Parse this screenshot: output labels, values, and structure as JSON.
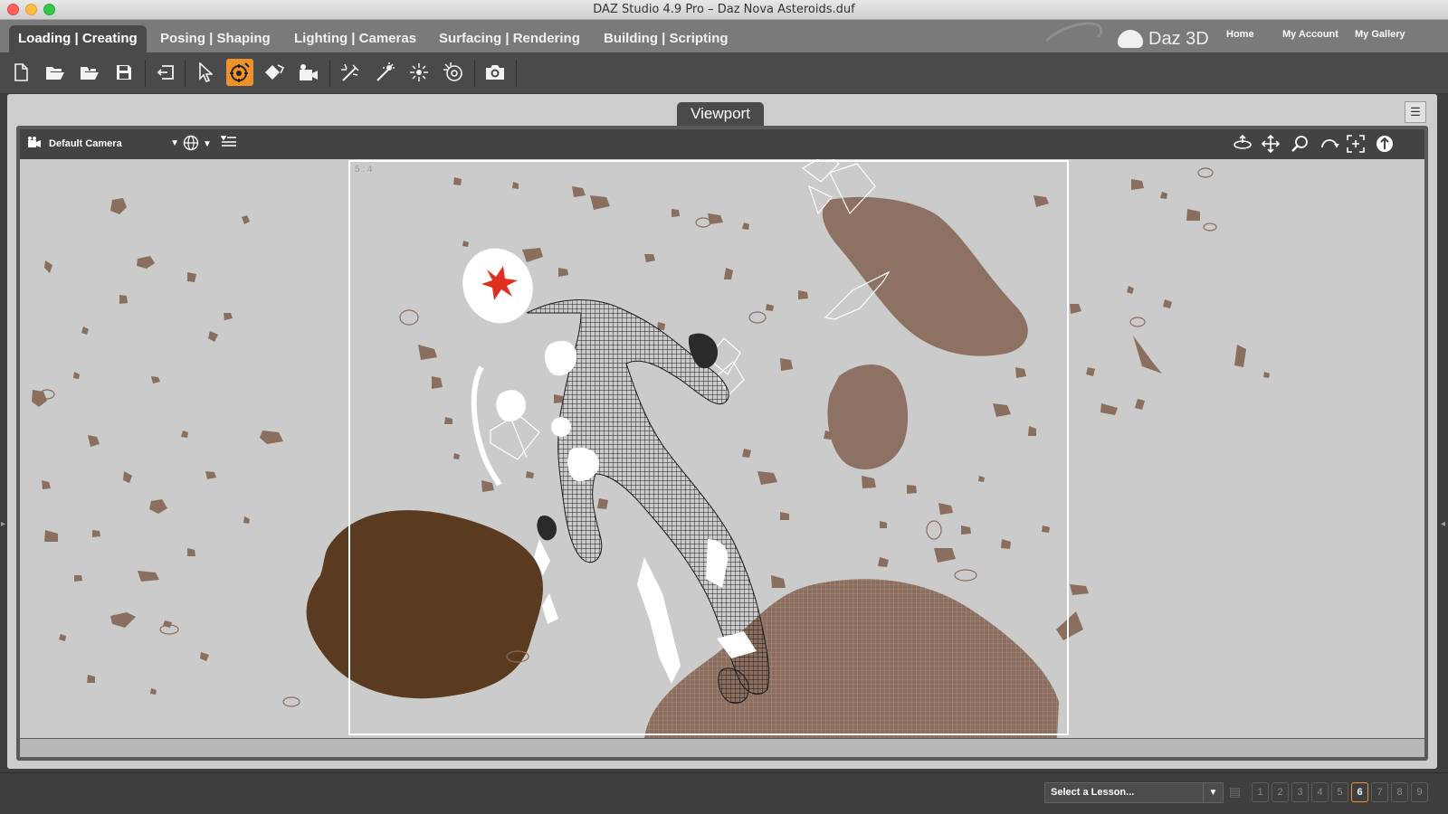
{
  "window": {
    "title": "DAZ Studio 4.9 Pro – Daz Nova Asteroids.duf"
  },
  "tabs": [
    {
      "label": "Loading | Creating",
      "active": true
    },
    {
      "label": "Posing | Shaping",
      "active": false
    },
    {
      "label": "Lighting | Cameras",
      "active": false
    },
    {
      "label": "Surfacing | Rendering",
      "active": false
    },
    {
      "label": "Building | Scripting",
      "active": false
    }
  ],
  "brand": {
    "name": "Daz 3D"
  },
  "top_links": {
    "home": "Home",
    "account": "My Account",
    "gallery": "My Gallery"
  },
  "toolbar": {
    "tools": [
      {
        "name": "new-file-icon",
        "glyph": "🗋"
      },
      {
        "name": "open-file-icon",
        "glyph": "📂"
      },
      {
        "name": "merge-file-icon",
        "glyph": "📂"
      },
      {
        "name": "save-icon",
        "glyph": "💾"
      },
      {
        "name": "undo-icon",
        "glyph": "⎌"
      },
      {
        "name": "select-pointer-icon",
        "glyph": "⇱"
      },
      {
        "name": "universal-tool-icon",
        "glyph": "⊛",
        "active": true
      },
      {
        "name": "surface-selection-icon",
        "glyph": "◈"
      },
      {
        "name": "node-selection-icon",
        "glyph": "⌘"
      },
      {
        "name": "spot-light-icon",
        "glyph": "✦"
      },
      {
        "name": "point-light-icon",
        "glyph": "✧"
      },
      {
        "name": "distant-light-icon",
        "glyph": "✷"
      },
      {
        "name": "light-settings-icon",
        "glyph": "❂"
      },
      {
        "name": "render-camera-icon",
        "glyph": "📷"
      }
    ],
    "accent_color": "#f0922a"
  },
  "viewport": {
    "tab_label": "Viewport",
    "camera": "Default Camera",
    "aspect_label": "5 : 4"
  },
  "lesson": {
    "placeholder": "Select a Lesson...",
    "pages": [
      "1",
      "2",
      "3",
      "4",
      "5",
      "6",
      "7",
      "8",
      "9"
    ],
    "current_page": "6"
  },
  "colors": {
    "viewport_bg": "#cbcbcb",
    "asteroid_light": "#8a6e5e",
    "asteroid_dark": "#5a3a20",
    "tab_active_bg": "#4a4a4a"
  }
}
